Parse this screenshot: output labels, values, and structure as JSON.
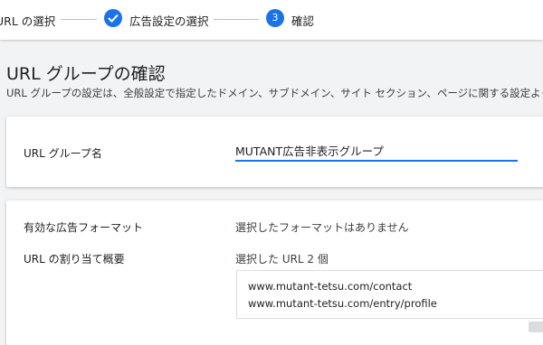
{
  "stepper": {
    "steps": [
      {
        "label": "URL の選択",
        "state": "done-partial"
      },
      {
        "label": "広告設定の選択",
        "state": "completed"
      },
      {
        "number": "3",
        "label": "確認",
        "state": "current"
      }
    ]
  },
  "page": {
    "title": "URL グループの確認",
    "description": "URL グループの設定は、全般設定で指定したドメイン、サブドメイン、サイト セクション、ページに関する設定より"
  },
  "group_card": {
    "name_label": "URL グループ名",
    "name_value": "MUTANT広告非表示グループ"
  },
  "detail_card": {
    "formats_label": "有効な広告フォーマット",
    "formats_value": "選択したフォーマットはありません",
    "urls_label": "URL の割り当て概要",
    "urls_summary": "選択した URL 2 個",
    "urls": [
      "www.mutant-tetsu.com/contact",
      "www.mutant-tetsu.com/entry/profile"
    ]
  },
  "colors": {
    "accent": "#1a73e8",
    "background": "#f1f3f4",
    "card": "#ffffff"
  },
  "icons": {
    "completed_step": "check-icon"
  }
}
